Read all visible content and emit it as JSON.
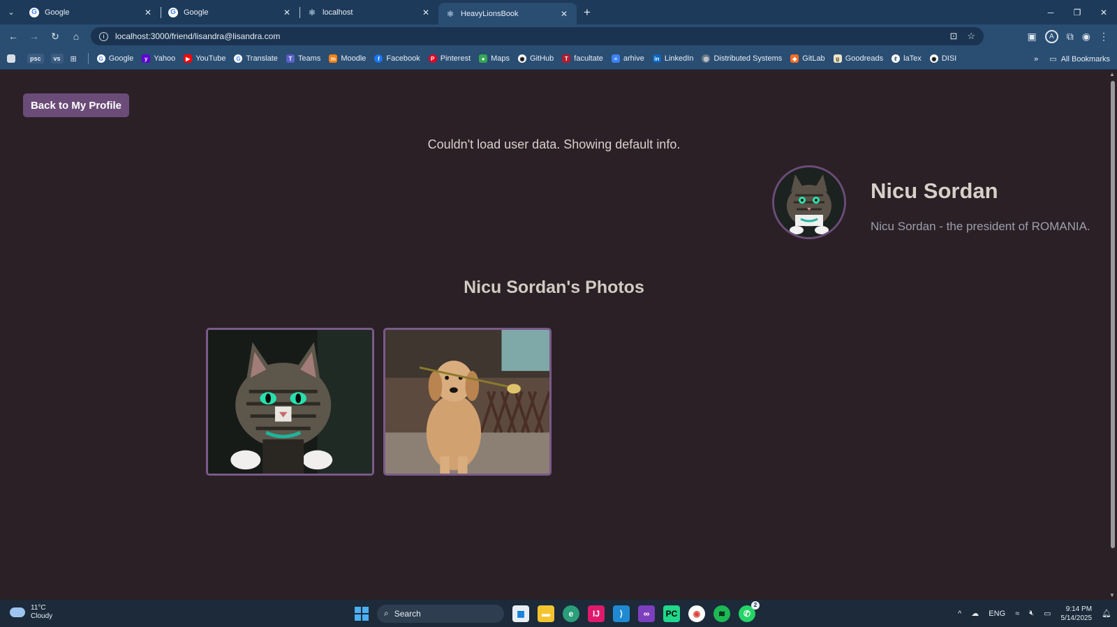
{
  "browser": {
    "tabs": [
      {
        "title": "Google",
        "icon": "google-icon",
        "active": false
      },
      {
        "title": "Google",
        "icon": "google-icon",
        "active": false
      },
      {
        "title": "localhost",
        "icon": "react-icon",
        "active": false
      },
      {
        "title": "HeavyLionsBook",
        "icon": "react-icon",
        "active": true
      }
    ],
    "url": "localhost:3000/friend/lisandra@lisandra.com",
    "bookmarks": [
      "Google",
      "Yahoo",
      "YouTube",
      "Translate",
      "Teams",
      "Moodle",
      "Facebook",
      "Pinterest",
      "Maps",
      "GitHub",
      "facultate",
      "arhive",
      "LinkedIn",
      "Distributed Systems",
      "GitLab",
      "Goodreads",
      "laTex",
      "DISI"
    ],
    "bookmark_chips": [
      "psc",
      "vs"
    ],
    "all_bookmarks": "All Bookmarks",
    "profile_initial": "A"
  },
  "page": {
    "back_button": "Back to My Profile",
    "error_message": "Couldn't load user data. Showing default info.",
    "profile": {
      "name": "Nicu Sordan",
      "bio": "Nicu Sordan - the president of ROMANIA."
    },
    "photos_title": "Nicu Sordan's Photos",
    "photos": [
      {
        "alt": "cat"
      },
      {
        "alt": "dog with rose"
      }
    ]
  },
  "taskbar": {
    "weather_temp": "11°C",
    "weather_desc": "Cloudy",
    "search_placeholder": "Search",
    "language": "ENG",
    "time": "9:14 PM",
    "date": "5/14/2025",
    "whatsapp_badge": "2"
  },
  "colors": {
    "page_bg": "#2b2026",
    "accent": "#6b4c78",
    "tab_bar": "#1d3a5a",
    "toolbar": "#2a4d72"
  }
}
